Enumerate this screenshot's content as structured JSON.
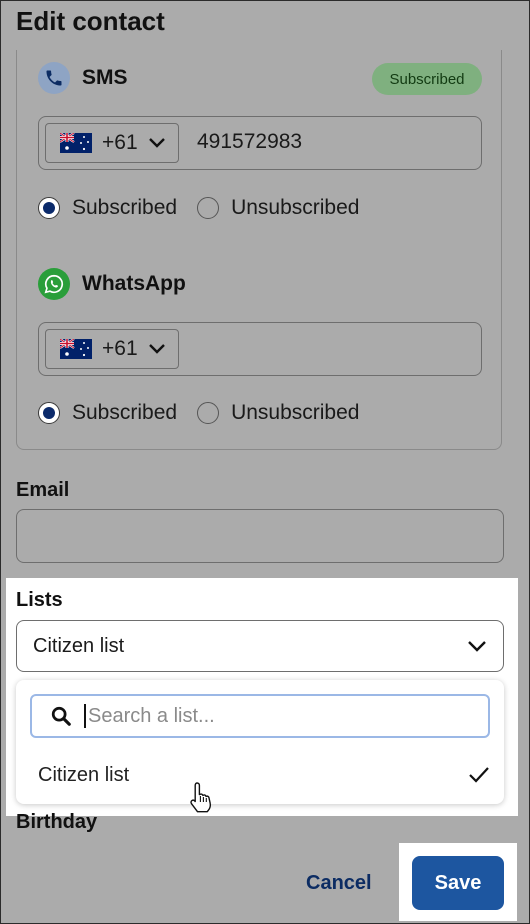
{
  "page": {
    "title": "Edit contact"
  },
  "sms": {
    "label": "SMS",
    "status_badge": "Subscribed",
    "country_code": "+61",
    "phone": "491572983",
    "radio_subscribed": "Subscribed",
    "radio_unsubscribed": "Unsubscribed",
    "selected": "Subscribed"
  },
  "whatsapp": {
    "label": "WhatsApp",
    "country_code": "+61",
    "phone": "",
    "radio_subscribed": "Subscribed",
    "radio_unsubscribed": "Unsubscribed",
    "selected": "Subscribed"
  },
  "email": {
    "label": "Email",
    "value": ""
  },
  "lists": {
    "label": "Lists",
    "selected": "Citizen list",
    "search_placeholder": "Search a list...",
    "options": [
      {
        "label": "Citizen list",
        "checked": true
      }
    ]
  },
  "birthday": {
    "label": "Birthday"
  },
  "footer": {
    "cancel_label": "Cancel",
    "save_label": "Save"
  },
  "icons": {
    "sms": "phone-icon",
    "whatsapp": "whatsapp-icon",
    "flag": "australia-flag-icon",
    "chevron": "chevron-down-icon",
    "search": "search-icon",
    "check": "check-icon",
    "cursor": "hand-pointer-icon"
  },
  "colors": {
    "overlay": "#ababab",
    "primary": "#1d56a0",
    "badge_bg": "#7fb07f",
    "radio_fill": "#0b2a6b",
    "search_focus": "#9bb8e6"
  }
}
